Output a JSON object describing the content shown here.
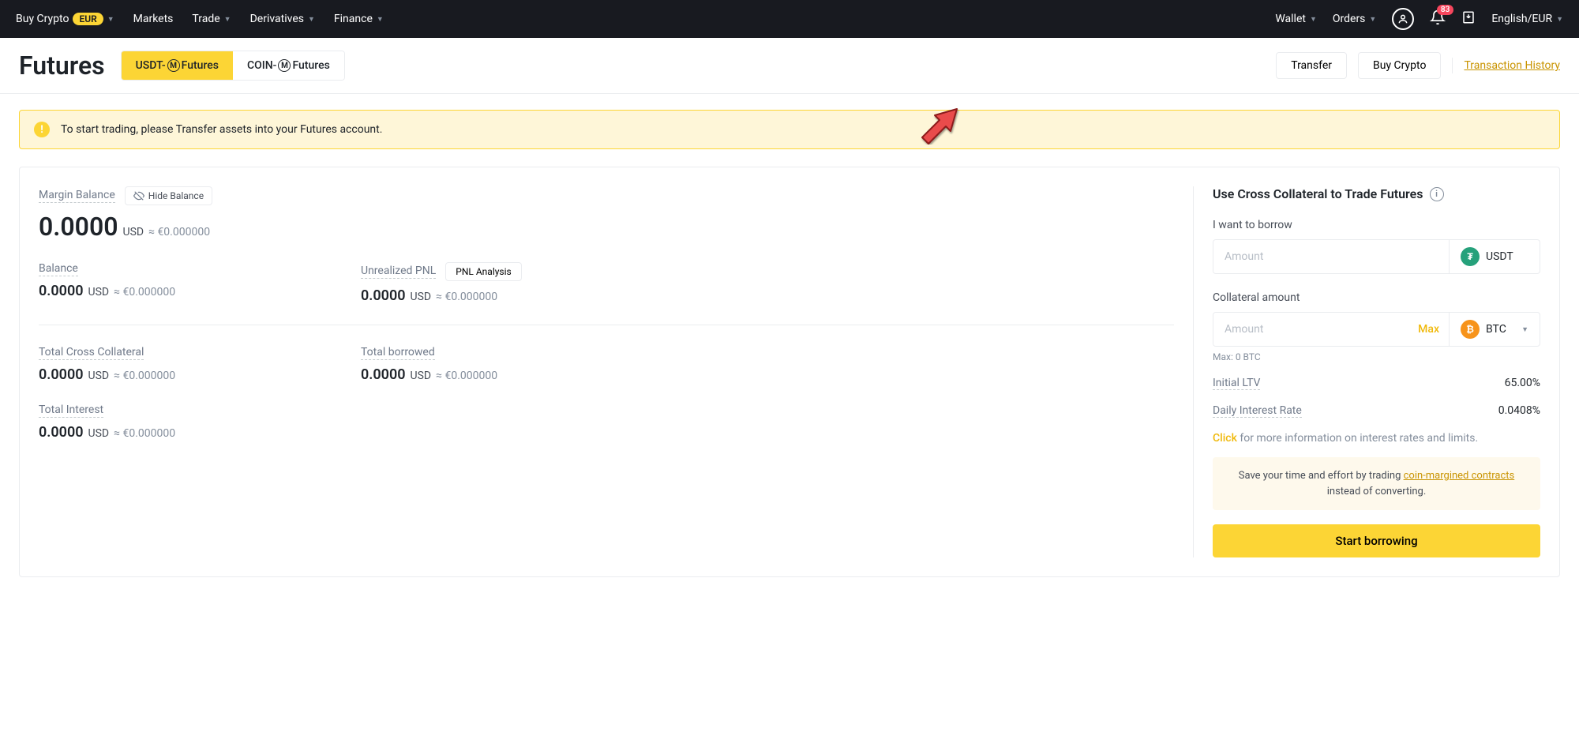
{
  "header": {
    "buy_crypto": "Buy Crypto",
    "eur_badge": "EUR",
    "markets": "Markets",
    "trade": "Trade",
    "derivatives": "Derivatives",
    "finance": "Finance",
    "wallet": "Wallet",
    "orders": "Orders",
    "notification_count": "83",
    "locale": "English/EUR"
  },
  "page": {
    "title": "Futures",
    "tab1_prefix": "USDT-",
    "tab1_suffix": " Futures",
    "tab2_prefix": "COIN-",
    "tab2_suffix": " Futures",
    "m_glyph": "M",
    "transfer": "Transfer",
    "buy_crypto": "Buy Crypto",
    "tx_history": "Transaction History"
  },
  "alert": {
    "text": "To start trading, please Transfer assets into your Futures account."
  },
  "stats": {
    "margin_balance": {
      "label": "Margin Balance",
      "hide": "Hide Balance",
      "value": "0.0000",
      "cur": "USD",
      "approx": "≈ €0.000000"
    },
    "balance": {
      "label": "Balance",
      "value": "0.0000",
      "cur": "USD",
      "approx": "≈ €0.000000"
    },
    "unrealized_pnl": {
      "label": "Unrealized PNL",
      "pnl_btn": "PNL Analysis",
      "value": "0.0000",
      "cur": "USD",
      "approx": "≈ €0.000000"
    },
    "cross_collateral": {
      "label": "Total Cross Collateral",
      "value": "0.0000",
      "cur": "USD",
      "approx": "≈ €0.000000"
    },
    "total_borrowed": {
      "label": "Total borrowed",
      "value": "0.0000",
      "cur": "USD",
      "approx": "≈ €0.000000"
    },
    "total_interest": {
      "label": "Total Interest",
      "value": "0.0000",
      "cur": "USD",
      "approx": "≈ €0.000000"
    }
  },
  "panel": {
    "title": "Use Cross Collateral to Trade Futures",
    "borrow_label": "I want to borrow",
    "amount_placeholder": "Amount",
    "usdt": "USDT",
    "collateral_label": "Collateral amount",
    "max": "Max",
    "btc": "BTC",
    "max_hint": "Max: 0 BTC",
    "ltv_label": "Initial LTV",
    "ltv_value": "65.00%",
    "dir_label": "Daily Interest Rate",
    "dir_value": "0.0408%",
    "click_word": "Click",
    "info_rest": " for more information on interest rates and limits.",
    "save_pre": "Save your time and effort by trading ",
    "save_link": "coin-margined contracts",
    "save_post": " instead of converting.",
    "start": "Start borrowing"
  }
}
